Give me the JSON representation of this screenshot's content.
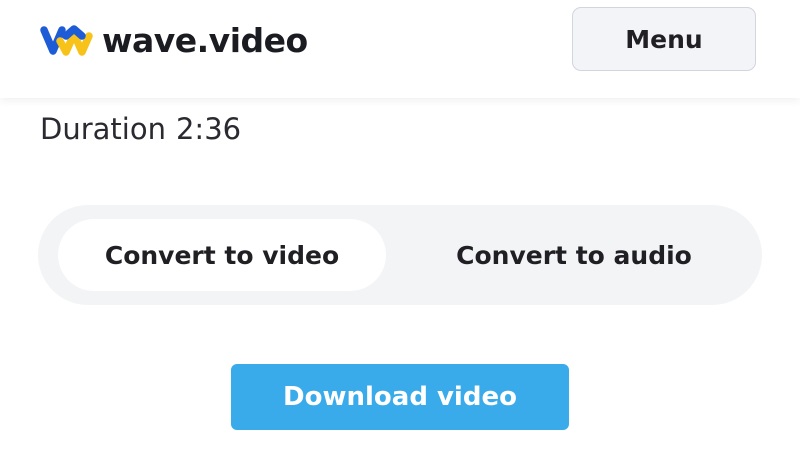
{
  "header": {
    "logo_text": "wave.video",
    "menu_label": "Menu"
  },
  "media": {
    "duration_label": "Duration",
    "duration_value": "2:36"
  },
  "convert_toggle": {
    "options": [
      {
        "label": "Convert to video",
        "selected": true
      },
      {
        "label": "Convert to audio",
        "selected": false
      }
    ]
  },
  "actions": {
    "download_label": "Download video"
  },
  "colors": {
    "logo_blue": "#1e5bd6",
    "logo_yellow": "#f7c31a",
    "download_button": "#3aabea",
    "toggle_track": "#f3f4f6",
    "menu_button_bg": "#f3f4f8"
  }
}
